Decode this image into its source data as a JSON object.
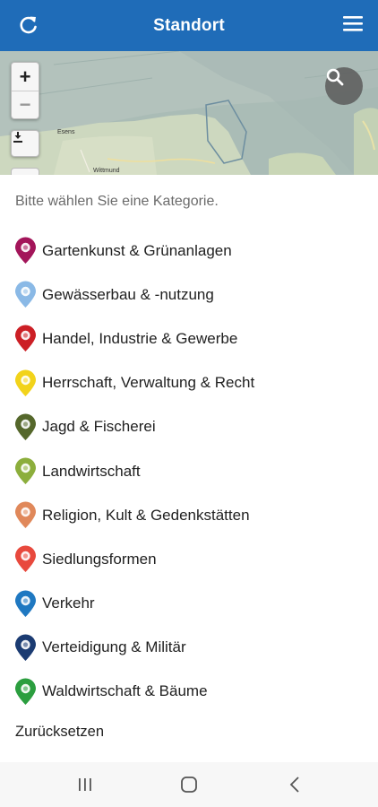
{
  "header": {
    "title": "Standort",
    "bg_color": "#1f6cb8",
    "refresh_icon": "refresh-icon",
    "menu_icon": "hamburger-menu-icon"
  },
  "map": {
    "zoom_in": "+",
    "zoom_out": "−",
    "labels": [
      "Esens",
      "Wittmund"
    ]
  },
  "prompt": "Bitte wählen Sie eine Kategorie.",
  "categories": [
    {
      "label": "Gartenkunst & Grünanlagen",
      "color": "#a3155a",
      "icon": "tree-icon"
    },
    {
      "label": "Gewässerbau & -nutzung",
      "color": "#8ab9e6",
      "icon": "water-icon"
    },
    {
      "label": "Handel, Industrie & Gewerbe",
      "color": "#cc1f25",
      "icon": "factory-icon"
    },
    {
      "label": "Herrschaft, Verwaltung & Recht",
      "color": "#f2d31b",
      "icon": "building-icon"
    },
    {
      "label": "Jagd & Fischerei",
      "color": "#55672b",
      "icon": "deer-icon"
    },
    {
      "label": "Landwirtschaft",
      "color": "#8cae3c",
      "icon": "wheat-icon"
    },
    {
      "label": "Religion, Kult & Gedenkstätten",
      "color": "#e0885a",
      "icon": "church-icon"
    },
    {
      "label": "Siedlungsformen",
      "color": "#e8493d",
      "icon": "house-icon"
    },
    {
      "label": "Verkehr",
      "color": "#1f78c1",
      "icon": "bicycle-icon"
    },
    {
      "label": "Verteidigung & Militär",
      "color": "#1b3b72",
      "icon": "helmet-icon"
    },
    {
      "label": "Waldwirtschaft & Bäume",
      "color": "#2b9e3f",
      "icon": "forest-icon"
    }
  ],
  "reset": "Zurücksetzen",
  "navbar": {
    "recent_icon": "recent-apps-icon",
    "home_icon": "home-icon",
    "back_icon": "back-icon"
  }
}
